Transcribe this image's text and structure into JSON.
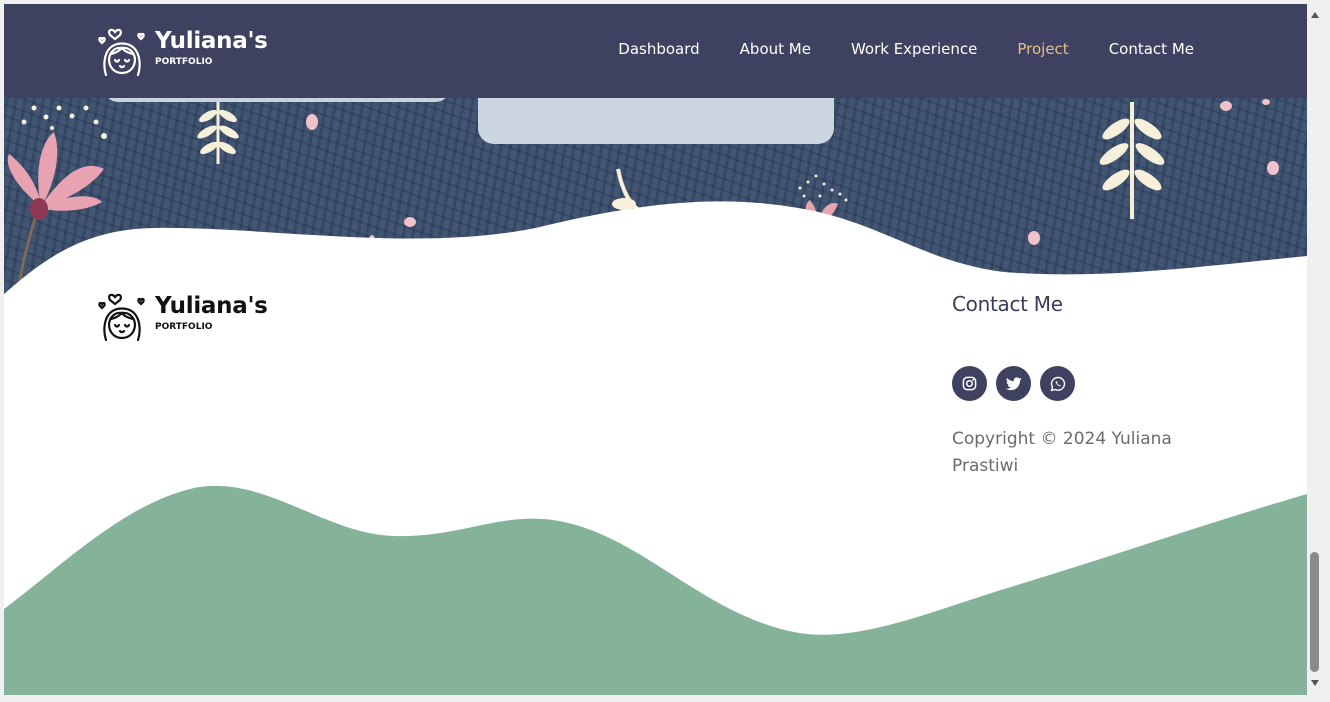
{
  "brand": {
    "name": "Yuliana's",
    "subtitle": "PORTFOLIO"
  },
  "nav": {
    "items": [
      {
        "label": "Dashboard",
        "active": false
      },
      {
        "label": "About Me",
        "active": false
      },
      {
        "label": "Work Experience",
        "active": false
      },
      {
        "label": "Project",
        "active": true
      },
      {
        "label": "Contact Me",
        "active": false
      }
    ]
  },
  "footer": {
    "contact_title": "Contact Me",
    "socials": [
      {
        "icon": "instagram-icon"
      },
      {
        "icon": "twitter-icon"
      },
      {
        "icon": "whatsapp-icon"
      }
    ],
    "copyright": "Copyright © 2024 Yuliana Prastiwi"
  },
  "colors": {
    "nav_bg": "#3e4160",
    "nav_active": "#e9be8a",
    "hero_bg": "#425673",
    "wave_green": "#84b39a",
    "text_dark": "#3a3d5c"
  }
}
